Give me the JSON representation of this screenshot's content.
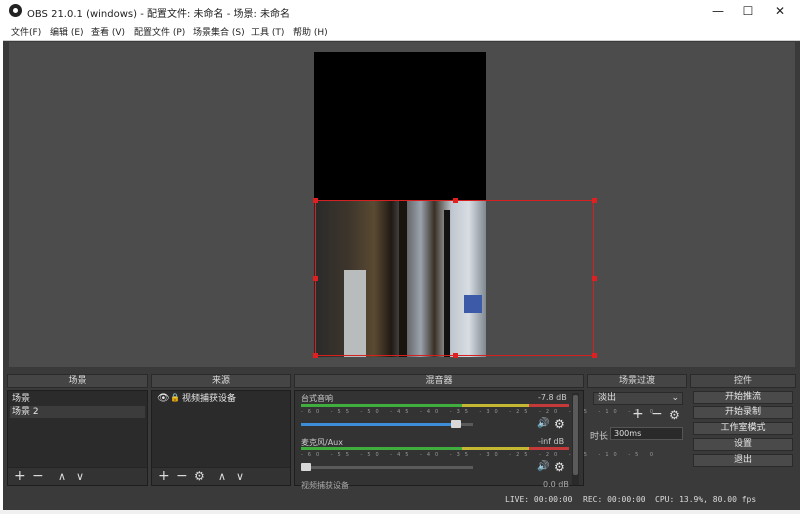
{
  "window": {
    "title": "OBS 21.0.1 (windows) - 配置文件: 未命名 - 场景: 未命名",
    "minimize": "—",
    "maximize": "☐",
    "close": "✕"
  },
  "menu": [
    "文件(F)",
    "编辑 (E)",
    "查看 (V)",
    "配置文件 (P)",
    "场景集合 (S)",
    "工具 (T)",
    "帮助 (H)"
  ],
  "docks": {
    "scenes": {
      "title": "场景",
      "items": [
        "场景",
        "场景 2"
      ]
    },
    "sources": {
      "title": "来源",
      "items": [
        "视频捕获设备"
      ]
    },
    "mixer": {
      "title": "混音器",
      "channels": [
        {
          "name": "台式音响",
          "db": "-7.8 dB",
          "volume": 0.9
        },
        {
          "name": "麦克风/Aux",
          "db": "-inf dB",
          "volume": 0.0
        },
        {
          "name": "视频捕获设备",
          "db": "0.0 dB"
        }
      ],
      "ticks": "-60 -55 -50 -45 -40 -35 -30 -25 -20 -15 -10 -5 0"
    },
    "transitions": {
      "title": "场景过渡",
      "selected": "淡出",
      "duration_label": "时长",
      "duration_value": "300ms"
    },
    "controls": {
      "title": "控件",
      "buttons": [
        "开始推流",
        "开始录制",
        "工作室模式",
        "设置",
        "退出"
      ]
    }
  },
  "toolbar": {
    "add": "+",
    "remove": "−",
    "up": "∧",
    "down": "∨",
    "gear": "⚙"
  },
  "status": {
    "live": "LIVE: 00:00:00",
    "rec": "REC: 00:00:00",
    "cpu": "CPU: 13.9%, 80.00 fps"
  },
  "colors": {
    "selection": "#d42020",
    "volume_fill": "#3c8ed8"
  }
}
